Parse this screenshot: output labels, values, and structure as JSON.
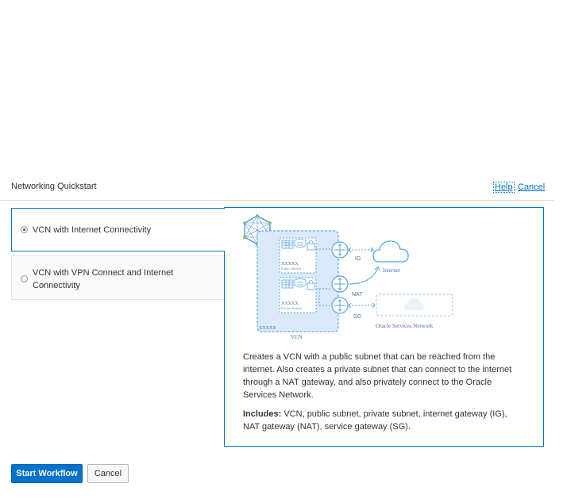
{
  "dialog": {
    "title": "Networking Quickstart",
    "help_link": "Help",
    "cancel_link": "Cancel"
  },
  "options": [
    {
      "label": "VCN with Internet Connectivity",
      "selected": true
    },
    {
      "label": "VCN with VPN Connect and Internet Connectivity",
      "selected": false
    }
  ],
  "diagram": {
    "public_subnet_id": "XXXXX",
    "public_subnet_label": "Public Subnet",
    "private_subnet_id": "XXXXX",
    "private_subnet_label": "Private Subnet",
    "vcn_id": "XXXXX",
    "vcn_label": "VCN",
    "ig_label": "IG",
    "nat_label": "NAT",
    "sg_label": "SG",
    "internet_label": "Internet",
    "oracle_services_label": "Oracle Services Network",
    "accent_color": "#5aa4e6",
    "fill_color": "#dbeaf9"
  },
  "description": "Creates a VCN with a public subnet that can be reached from the internet. Also creates a private subnet that can connect to the internet through a NAT gateway, and also privately connect to the Oracle Services Network.",
  "includes": {
    "label": "Includes:",
    "text": " VCN, public subnet, private subnet, internet gateway (IG), NAT gateway (NAT), service gateway (SG)."
  },
  "buttons": {
    "start_workflow": "Start Workflow",
    "cancel": "Cancel"
  }
}
